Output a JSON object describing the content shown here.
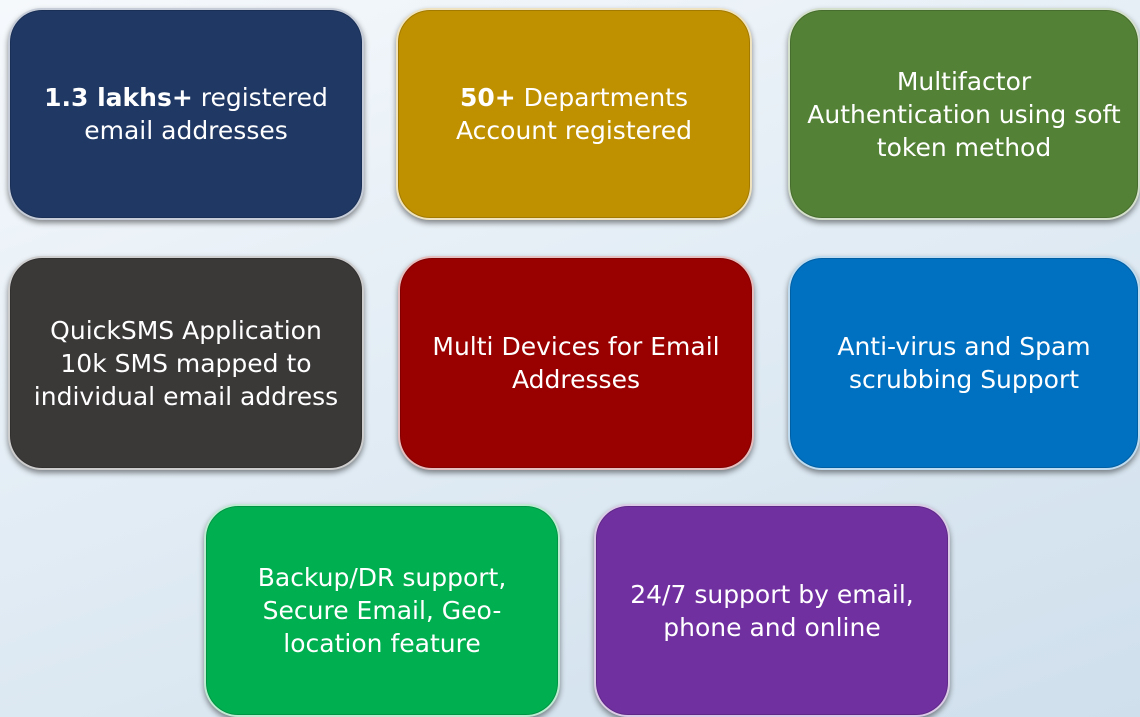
{
  "tiles": [
    {
      "bold": "1.3 lakhs+",
      "text": " registered email addresses",
      "color": "#1f3864"
    },
    {
      "bold": "50+",
      "text": " Departments Account registered",
      "color": "#bf9000"
    },
    {
      "text": "Multifactor Authentication using soft token method",
      "color": "#538135"
    },
    {
      "text": "QuickSMS Application 10k SMS mapped to individual email address",
      "color": "#3b3838"
    },
    {
      "text": "Multi Devices for Email Addresses",
      "color": "#990000"
    },
    {
      "text": "Anti-virus and Spam scrubbing Support",
      "color": "#0070c0"
    },
    {
      "text": "Backup/DR support, Secure Email, Geo-location feature",
      "color": "#00b050"
    },
    {
      "text": "24/7 support by email, phone and online",
      "color": "#7030a0"
    }
  ]
}
